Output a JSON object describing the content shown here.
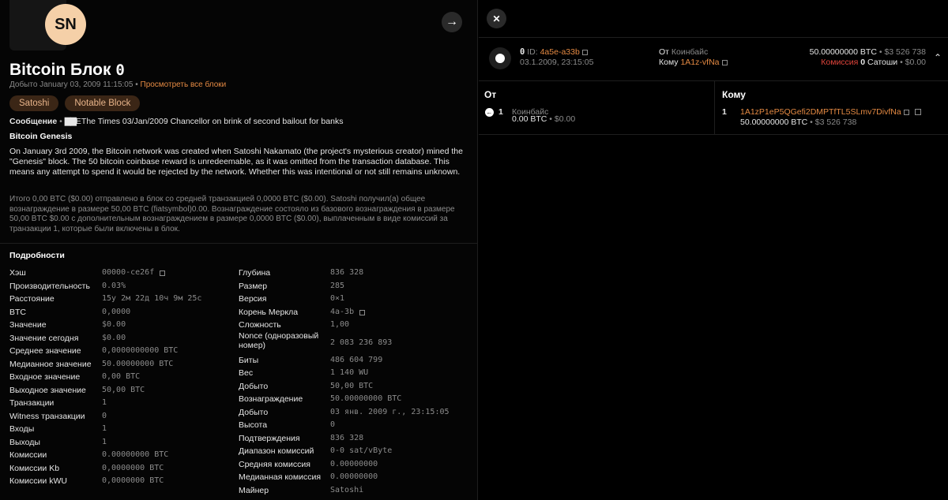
{
  "block": {
    "avatar_initials": "SN",
    "title": "Bitcoin Блок",
    "height_badge": "0",
    "mined_label": "Добыто January 03, 2009 11:15:05",
    "bullet": "•",
    "view_all_link": "Просмотреть все блоки",
    "tags": [
      "Satoshi",
      "Notable Block"
    ],
    "message_label": "Сообщение",
    "message_text": "EThe Times 03/Jan/2009 Chancellor on brink of second bailout for banks",
    "genesis_title": "Bitcoin Genesis",
    "genesis_desc": "On January 3rd 2009, the Bitcoin network was created when Satoshi Nakamato (the project's mysterious creator) mined the \"Genesis\" block. The 50 bitcoin coinbase reward is unredeemable, as it was omitted from the transaction database. This means any attempt to spend it would be rejected by the network. Whether this was intentional or not still remains unknown.",
    "summary": "Итого 0,00 BTC ($0.00) отправлено в блок со средней транзакцией 0,0000 BTC ($0.00). Satoshi получил(а) общее вознаграждение в размере 50,00 BTC (fiatsymbol)0.00. Вознаграждение состояло из базового вознаграждения в размере 50,00 BTC $0.00 с дополнительным вознаграждением в размере 0,0000 BTC ($0.00), выплаченным в виде комиссий за транзакции 1, которые были включены в блок."
  },
  "details": {
    "title": "Подробности",
    "left": [
      {
        "k": "Хэш",
        "v": "00000-ce26f"
      },
      {
        "k": "Производительность",
        "v": "0.03%"
      },
      {
        "k": "Расстояние",
        "v": "15y 2м 22д 10ч 9м 25c"
      },
      {
        "k": "BTC",
        "v": "0,0000"
      },
      {
        "k": "Значение",
        "v": "$0.00"
      },
      {
        "k": "Значение сегодня",
        "v": "$0.00"
      },
      {
        "k": "Среднее значение",
        "v": "0,0000000000 BTC"
      },
      {
        "k": "Медианное значение",
        "v": "50.00000000 BTC"
      },
      {
        "k": "Входное значение",
        "v": "0,00 BTC"
      },
      {
        "k": "Выходное значение",
        "v": "50,00 BTC"
      },
      {
        "k": "Транзакции",
        "v": "1"
      },
      {
        "k": "Witness транзакции",
        "v": "0"
      },
      {
        "k": "Входы",
        "v": "1"
      },
      {
        "k": "Выходы",
        "v": "1"
      },
      {
        "k": "Комиссии",
        "v": "0.00000000 BTC"
      },
      {
        "k": "Комиссии Kb",
        "v": "0,0000000 BTC"
      },
      {
        "k": "Комиссии kWU",
        "v": "0,0000000 BTC"
      }
    ],
    "right": [
      {
        "k": "Глубина",
        "v": "836 328"
      },
      {
        "k": "Размер",
        "v": "285"
      },
      {
        "k": "Версия",
        "v": "0×1"
      },
      {
        "k": "Корень Меркла",
        "v": "4a-3b"
      },
      {
        "k": "Сложность",
        "v": "1,00"
      },
      {
        "k": "Nonce (одноразовый номер)",
        "v": "2 083 236 893"
      },
      {
        "k": "Биты",
        "v": "486 604 799"
      },
      {
        "k": "Вес",
        "v": "1 140 WU"
      },
      {
        "k": "Добыто",
        "v": "50,00 BTC"
      },
      {
        "k": "Вознаграждение",
        "v": "50.00000000 BTC"
      },
      {
        "k": "Добыто",
        "v": "03 янв. 2009 г., 23:15:05"
      },
      {
        "k": "Высота",
        "v": "0"
      },
      {
        "k": "Подтверждения",
        "v": "836 328"
      },
      {
        "k": "Диапазон комиссий",
        "v": "0-0 sat/vByte"
      },
      {
        "k": "Средняя комиссия",
        "v": "0.00000000"
      },
      {
        "k": "Медианная комиссия",
        "v": "0.00000000"
      },
      {
        "k": "Майнер",
        "v": "Satoshi"
      }
    ]
  },
  "tx": {
    "index": "0",
    "id_label": "ID:",
    "id_value": "4a5e-a33b",
    "date": "03.1.2009, 23:15:05",
    "from_label": "От",
    "from_value": "Коинбайс",
    "to_label": "Кому",
    "to_value": "1A1z-vfNa",
    "amount": "50.00000000 BTC",
    "amount_usd": "$3 526 738",
    "fee_label": "Комиссия",
    "fee_value": "0",
    "fee_unit": "Сатоши",
    "fee_usd": "$0.00",
    "collapse_icon": "chevron-up-icon"
  },
  "io": {
    "from_header": "От",
    "to_header": "Кому",
    "input_index": "1",
    "input_source": "Коинбайс",
    "input_amount": "0.00 BTC",
    "input_usd": "$0.00",
    "output_index": "1",
    "output_address": "1A1zP1eP5QGefi2DMPTfTL5SLmv7DivfNa",
    "output_amount": "50.00000000 BTC",
    "output_usd": "$3 526 738"
  }
}
